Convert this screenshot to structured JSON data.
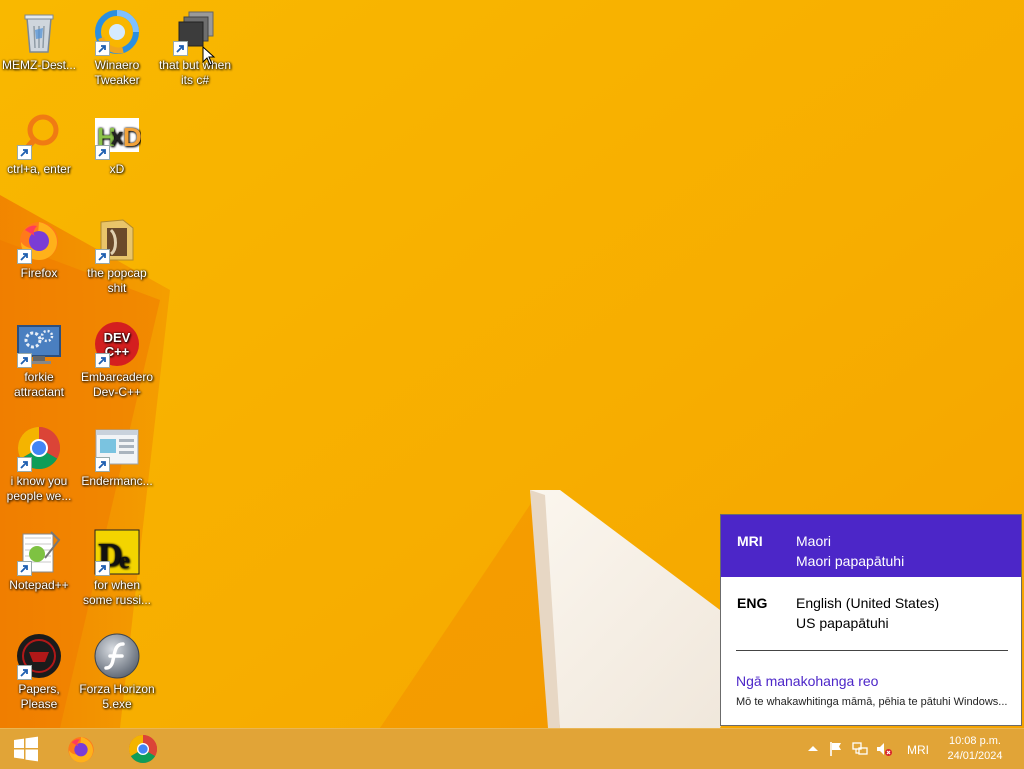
{
  "desktop": {
    "icons": [
      {
        "label": "MEMZ-Dest...",
        "icon": "recycle-bin-icon"
      },
      {
        "label": "Winaero Tweaker",
        "icon": "winaero-tweaker-icon"
      },
      {
        "label": "that but when its c#",
        "icon": "stacked-windows-icon"
      },
      {
        "label": "ctrl+a, enter",
        "icon": "magnifier-icon"
      },
      {
        "label": "xD",
        "icon": "hxd-icon"
      },
      {
        "label": "Firefox",
        "icon": "firefox-icon"
      },
      {
        "label": "the popcap shit",
        "icon": "folder-icon"
      },
      {
        "label": "forkie attractant",
        "icon": "monitor-gears-icon"
      },
      {
        "label": "Embarcadero Dev-C++",
        "icon": "devcpp-icon"
      },
      {
        "label": "i know you people we...",
        "icon": "chrome-icon"
      },
      {
        "label": "Endermanc...",
        "icon": "application-window-icon"
      },
      {
        "label": "Notepad++",
        "icon": "notepadpp-icon"
      },
      {
        "label": "for when some russi...",
        "icon": "de-icon"
      },
      {
        "label": "Papers, Please",
        "icon": "papers-please-icon"
      },
      {
        "label": "Forza Horizon 5.exe",
        "icon": "flash-icon"
      }
    ],
    "icon_text": {
      "devcpp": "DEV C++",
      "hxd": "HxD",
      "de": "De"
    }
  },
  "language_flyout": {
    "languages": [
      {
        "code": "MRI",
        "name": "Maori",
        "keyboard": "Maori papapātuhi"
      },
      {
        "code": "ENG",
        "name": "English (United States)",
        "keyboard": "US papapātuhi"
      }
    ],
    "preferences_link": "Ngā manakohanga reo",
    "preferences_desc": "Mō te whakawhitinga māmā, pēhia te pātuhi Windows..."
  },
  "taskbar": {
    "pinned": [
      "windows-start-icon",
      "firefox-icon",
      "chrome-icon"
    ],
    "tray": {
      "icons": [
        "show-hidden-icons-chevron",
        "action-center-flag-icon",
        "network-icon",
        "volume-muted-icon"
      ],
      "language": "MRI",
      "time": "10:08 p.m.",
      "date": "24/01/2024"
    }
  },
  "colors": {
    "accent": "#4c26c8",
    "wallpaper": "#f8b100",
    "taskbar": "#e1a437"
  }
}
